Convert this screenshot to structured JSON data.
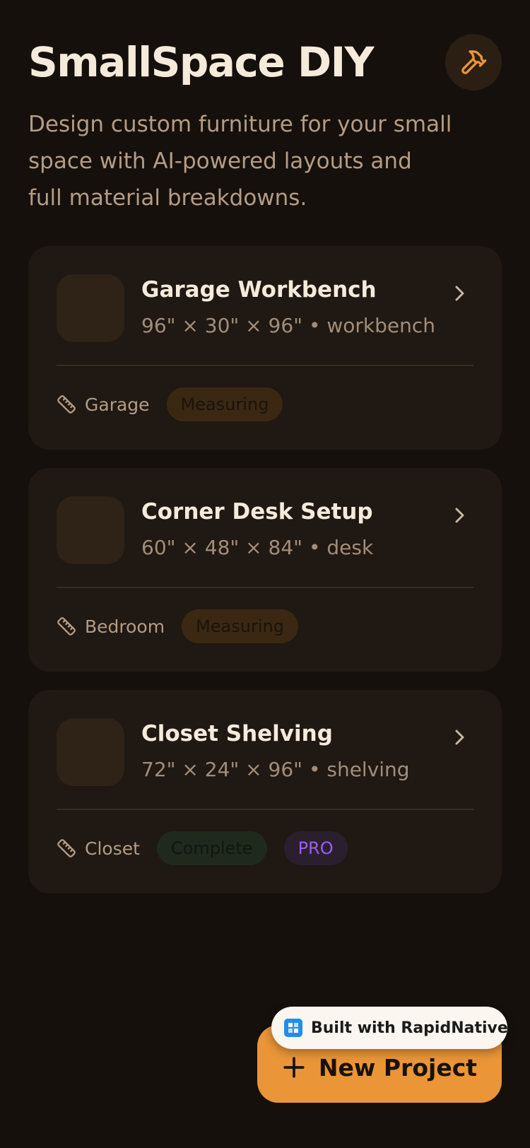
{
  "app": {
    "title": "SmallSpace DIY",
    "subtitle": "Design custom furniture for your small space with AI-powered layouts and full material breakdowns."
  },
  "projects": [
    {
      "name": "Garage Workbench",
      "dims": "96\" × 30\" × 96\" • workbench",
      "location": "Garage",
      "status": "Measuring"
    },
    {
      "name": "Corner Desk Setup",
      "dims": "60\" × 48\" × 84\" • desk",
      "location": "Bedroom",
      "status": "Measuring"
    },
    {
      "name": "Closet Shelving",
      "dims": "72\" × 24\" × 96\" • shelving",
      "location": "Closet",
      "status": "Complete",
      "tag": "PRO"
    }
  ],
  "fab": {
    "label": "New Project"
  },
  "badge": {
    "label": "Built with RapidNative"
  },
  "colors": {
    "background": "#15100c",
    "card": "#1f1813",
    "accent": "#ea9538",
    "pro": "#9b5cf0"
  },
  "icons": {
    "header_button": "hammer-icon",
    "card_action": "chevron-right-icon",
    "location": "ruler-icon",
    "fab": "plus-icon",
    "badge": "rapidnative-logo-icon"
  }
}
